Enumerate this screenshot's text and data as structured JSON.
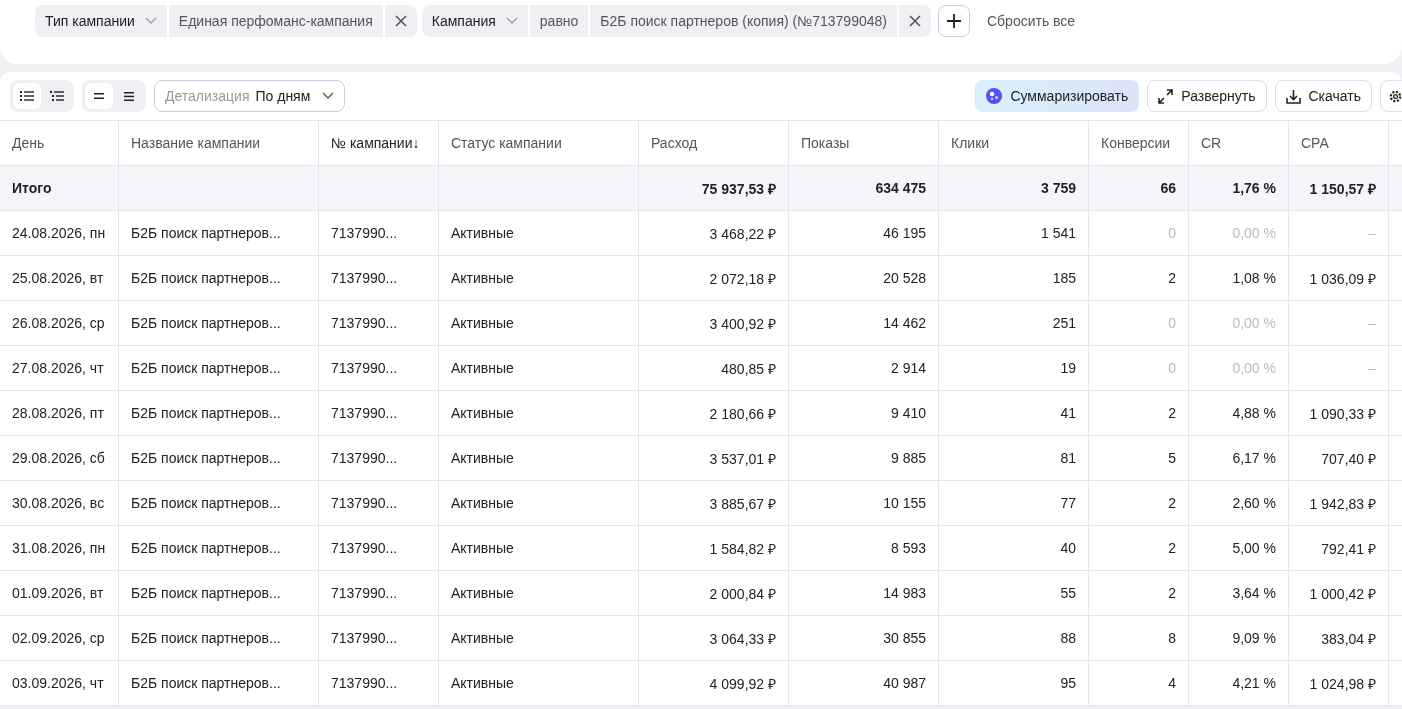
{
  "filters": [
    {
      "field": "Тип кампании",
      "value": "Единая перфоманс-кампания"
    },
    {
      "field": "Кампания",
      "operator": "равно",
      "value": "Б2Б поиск партнеров (копия) (№713799048)"
    }
  ],
  "reset_label": "Сбросить все",
  "view_toggles": [
    [
      {
        "selected": true
      },
      {
        "selected": false
      }
    ],
    [
      {
        "selected": true
      },
      {
        "selected": false
      }
    ]
  ],
  "detail": {
    "label": "Детализация",
    "value": "По дням"
  },
  "actions": [
    {
      "kind": "ai",
      "label": "Суммаризировать"
    },
    {
      "kind": "expand",
      "label": "Развернуть"
    },
    {
      "kind": "download",
      "label": "Скачать"
    },
    {
      "kind": "settings"
    }
  ],
  "table": {
    "columns": [
      {
        "label": "День"
      },
      {
        "label": "Название кампании"
      },
      {
        "label": "№ кампании↓",
        "sorted": true
      },
      {
        "label": "Статус кампании"
      },
      {
        "label": "Расход"
      },
      {
        "label": "Показы"
      },
      {
        "label": "Клики"
      },
      {
        "label": "Конверсии"
      },
      {
        "label": "CR"
      },
      {
        "label": "CPA"
      }
    ],
    "total": {
      "label": "Итого",
      "values": [
        "75 937,53 ₽",
        "634 475",
        "3 759",
        "66",
        "1,76 %",
        "1 150,57 ₽"
      ]
    },
    "rows": [
      {
        "empty": true,
        "cells": [
          "24.08.2026, пн",
          "Б2Б поиск партнеров...",
          "7137990...",
          "Активные",
          "3 468,22 ₽",
          "46 195",
          "1 541",
          "0",
          "0,00 %",
          "–"
        ]
      },
      {
        "empty": false,
        "cells": [
          "25.08.2026, вт",
          "Б2Б поиск партнеров...",
          "7137990...",
          "Активные",
          "2 072,18 ₽",
          "20 528",
          "185",
          "2",
          "1,08 %",
          "1 036,09 ₽"
        ]
      },
      {
        "empty": true,
        "cells": [
          "26.08.2026, ср",
          "Б2Б поиск партнеров...",
          "7137990...",
          "Активные",
          "3 400,92 ₽",
          "14 462",
          "251",
          "0",
          "0,00 %",
          "–"
        ]
      },
      {
        "empty": true,
        "cells": [
          "27.08.2026, чт",
          "Б2Б поиск партнеров...",
          "7137990...",
          "Активные",
          "480,85 ₽",
          "2 914",
          "19",
          "0",
          "0,00 %",
          "–"
        ]
      },
      {
        "empty": false,
        "cells": [
          "28.08.2026, пт",
          "Б2Б поиск партнеров...",
          "7137990...",
          "Активные",
          "2 180,66 ₽",
          "9 410",
          "41",
          "2",
          "4,88 %",
          "1 090,33 ₽"
        ]
      },
      {
        "empty": false,
        "cells": [
          "29.08.2026, сб",
          "Б2Б поиск партнеров...",
          "7137990...",
          "Активные",
          "3 537,01 ₽",
          "9 885",
          "81",
          "5",
          "6,17 %",
          "707,40 ₽"
        ]
      },
      {
        "empty": false,
        "cells": [
          "30.08.2026, вс",
          "Б2Б поиск партнеров...",
          "7137990...",
          "Активные",
          "3 885,67 ₽",
          "10 155",
          "77",
          "2",
          "2,60 %",
          "1 942,83 ₽"
        ]
      },
      {
        "empty": false,
        "cells": [
          "31.08.2026, пн",
          "Б2Б поиск партнеров...",
          "7137990...",
          "Активные",
          "1 584,82 ₽",
          "8 593",
          "40",
          "2",
          "5,00 %",
          "792,41 ₽"
        ]
      },
      {
        "empty": false,
        "cells": [
          "01.09.2026, вт",
          "Б2Б поиск партнеров...",
          "7137990...",
          "Активные",
          "2 000,84 ₽",
          "14 983",
          "55",
          "2",
          "3,64 %",
          "1 000,42 ₽"
        ]
      },
      {
        "empty": false,
        "cells": [
          "02.09.2026, ср",
          "Б2Б поиск партнеров...",
          "7137990...",
          "Активные",
          "3 064,33 ₽",
          "30 855",
          "88",
          "8",
          "9,09 %",
          "383,04 ₽"
        ]
      },
      {
        "empty": false,
        "cells": [
          "03.09.2026, чт",
          "Б2Б поиск партнеров...",
          "7137990...",
          "Активные",
          "4 099,92 ₽",
          "40 987",
          "95",
          "4",
          "4,21 %",
          "1 024,98 ₽"
        ]
      }
    ]
  }
}
